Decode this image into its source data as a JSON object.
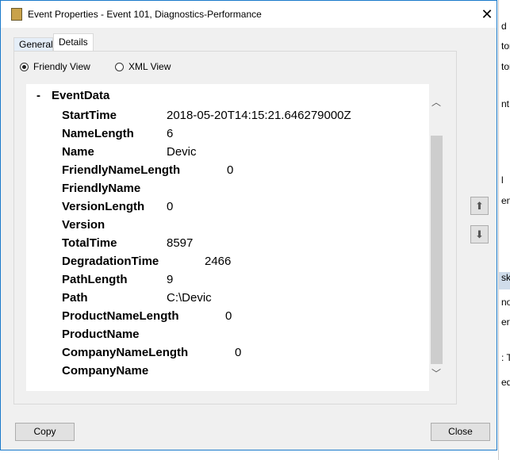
{
  "window": {
    "title": "Event Properties - Event 101, Diagnostics-Performance",
    "close_glyph": "✕"
  },
  "tabs": [
    {
      "label": "General"
    },
    {
      "label": "Details",
      "active": true
    }
  ],
  "view_options": [
    {
      "label": "Friendly View",
      "selected": true
    },
    {
      "label": "XML View",
      "selected": false
    }
  ],
  "event_data": {
    "header": "EventData",
    "toggle": "-",
    "fields": [
      {
        "name": "StartTime",
        "value": "2018-05-20T14:15:21.646279000Z"
      },
      {
        "name": "NameLength",
        "value": "6"
      },
      {
        "name": "Name",
        "value": "Devic"
      },
      {
        "name": "FriendlyNameLength",
        "value": "0"
      },
      {
        "name": "FriendlyName",
        "value": ""
      },
      {
        "name": "VersionLength",
        "value": "0"
      },
      {
        "name": "Version",
        "value": ""
      },
      {
        "name": "TotalTime",
        "value": "8597"
      },
      {
        "name": "DegradationTime",
        "value": "2466"
      },
      {
        "name": "PathLength",
        "value": "9"
      },
      {
        "name": "Path",
        "value": "C:\\Devic"
      },
      {
        "name": "ProductNameLength",
        "value": "0"
      },
      {
        "name": "ProductName",
        "value": ""
      },
      {
        "name": "CompanyNameLength",
        "value": "0"
      },
      {
        "name": "CompanyName",
        "value": ""
      }
    ]
  },
  "buttons": {
    "copy": "Copy",
    "close": "Close"
  },
  "background_fragments": [
    "d L",
    "tor",
    "tor",
    "nt",
    "l",
    "ent",
    "sk",
    "nos",
    "erti",
    ": Te",
    "ed"
  ],
  "colors": {
    "window_border": "#1979ca",
    "selected_row": "#cfdcea"
  }
}
